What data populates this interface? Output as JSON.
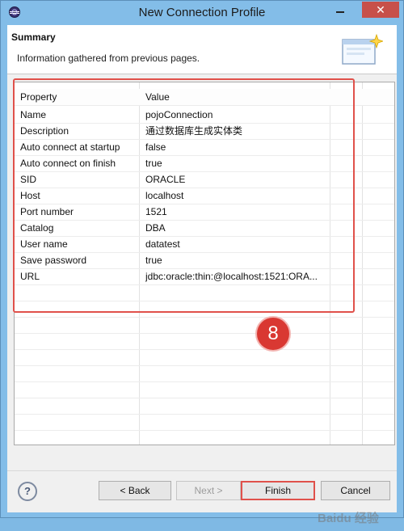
{
  "window": {
    "title": "New Connection Profile",
    "close_glyph": "✕"
  },
  "header": {
    "title": "Summary",
    "description": "Information gathered from previous pages."
  },
  "table": {
    "columns": [
      "Property",
      "Value"
    ],
    "rows": [
      {
        "property": "Name",
        "value": "pojoConnection"
      },
      {
        "property": "Description",
        "value": "通过数据库生成实体类"
      },
      {
        "property": "Auto connect at startup",
        "value": "false"
      },
      {
        "property": "Auto connect on finish",
        "value": "true"
      },
      {
        "property": "SID",
        "value": "ORACLE"
      },
      {
        "property": "Host",
        "value": "localhost"
      },
      {
        "property": "Port number",
        "value": "1521"
      },
      {
        "property": "Catalog",
        "value": "DBA"
      },
      {
        "property": "User name",
        "value": "datatest"
      },
      {
        "property": "Save password",
        "value": "true"
      },
      {
        "property": "URL",
        "value": "jdbc:oracle:thin:@localhost:1521:ORA..."
      }
    ]
  },
  "annotation": {
    "step_number": "8",
    "color": "#d93832"
  },
  "buttons": {
    "help": "?",
    "back": "< Back",
    "next": "Next >",
    "finish": "Finish",
    "cancel": "Cancel"
  },
  "watermark": "Baidu 经验"
}
